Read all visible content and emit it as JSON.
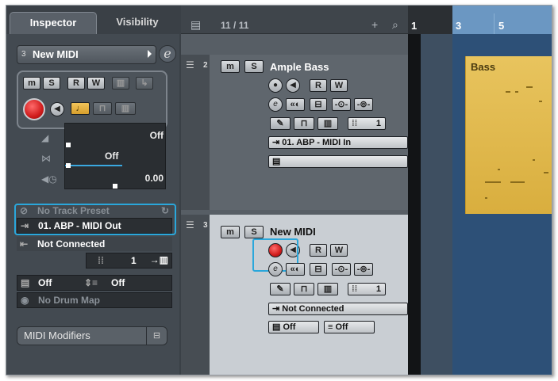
{
  "inspector": {
    "tabs": [
      {
        "label": "Inspector"
      },
      {
        "label": "Visibility"
      }
    ],
    "track_number": "3",
    "track_name": "New MIDI",
    "controls": {
      "mute": "m",
      "solo": "S",
      "read": "R",
      "write": "W"
    },
    "value_off_1": "Off",
    "value_off_2": "Off",
    "value_offset": "0.00",
    "track_preset": "No Track Preset",
    "midi_output": "01. ABP - MIDI Out",
    "midi_input": "Not Connected",
    "channel": "1",
    "bank": "Off",
    "program": "Off",
    "drum_map": "No Drum Map",
    "midi_modifiers": "MIDI Modifiers"
  },
  "tracklist": {
    "count": "11 / 11",
    "tracks": [
      {
        "number": "2",
        "name": "Ample Bass",
        "channel": "1",
        "input": "01. ABP - MIDI In"
      },
      {
        "number": "3",
        "name": "New MIDI",
        "channel": "1",
        "input": "Not Connected",
        "bank": "Off",
        "program": "Off"
      }
    ]
  },
  "ruler": {
    "markers": [
      "1",
      "3",
      "5"
    ]
  },
  "parts": [
    {
      "name": "Bass",
      "color": "#e2bb52"
    }
  ]
}
